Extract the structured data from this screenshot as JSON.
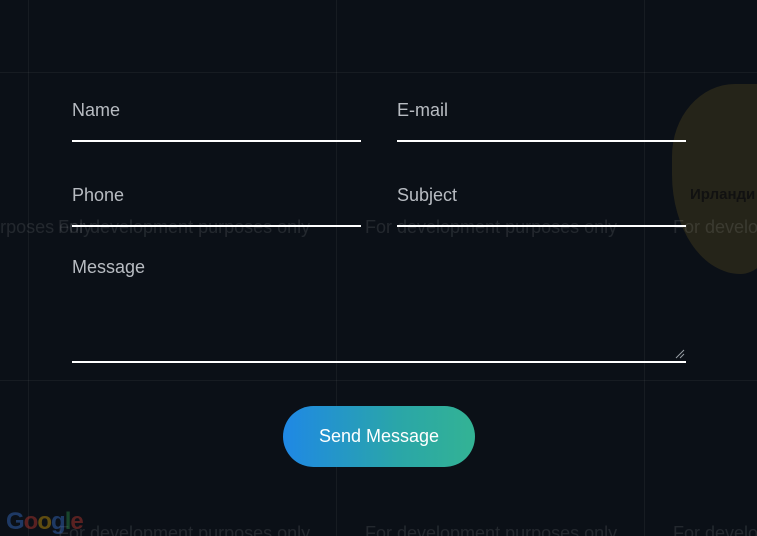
{
  "map": {
    "dev_notice": "For development purposes only",
    "region_label": "Ирланди",
    "google_logo": "Google"
  },
  "form": {
    "name_label": "Name",
    "email_label": "E-mail",
    "phone_label": "Phone",
    "subject_label": "Subject",
    "message_label": "Message",
    "send_label": "Send Message"
  },
  "colors": {
    "background": "#0b1017",
    "underline": "#ffffff",
    "label": "#b8bcc2",
    "button_gradient_start": "#1f88e5",
    "button_gradient_end": "#33b394"
  }
}
